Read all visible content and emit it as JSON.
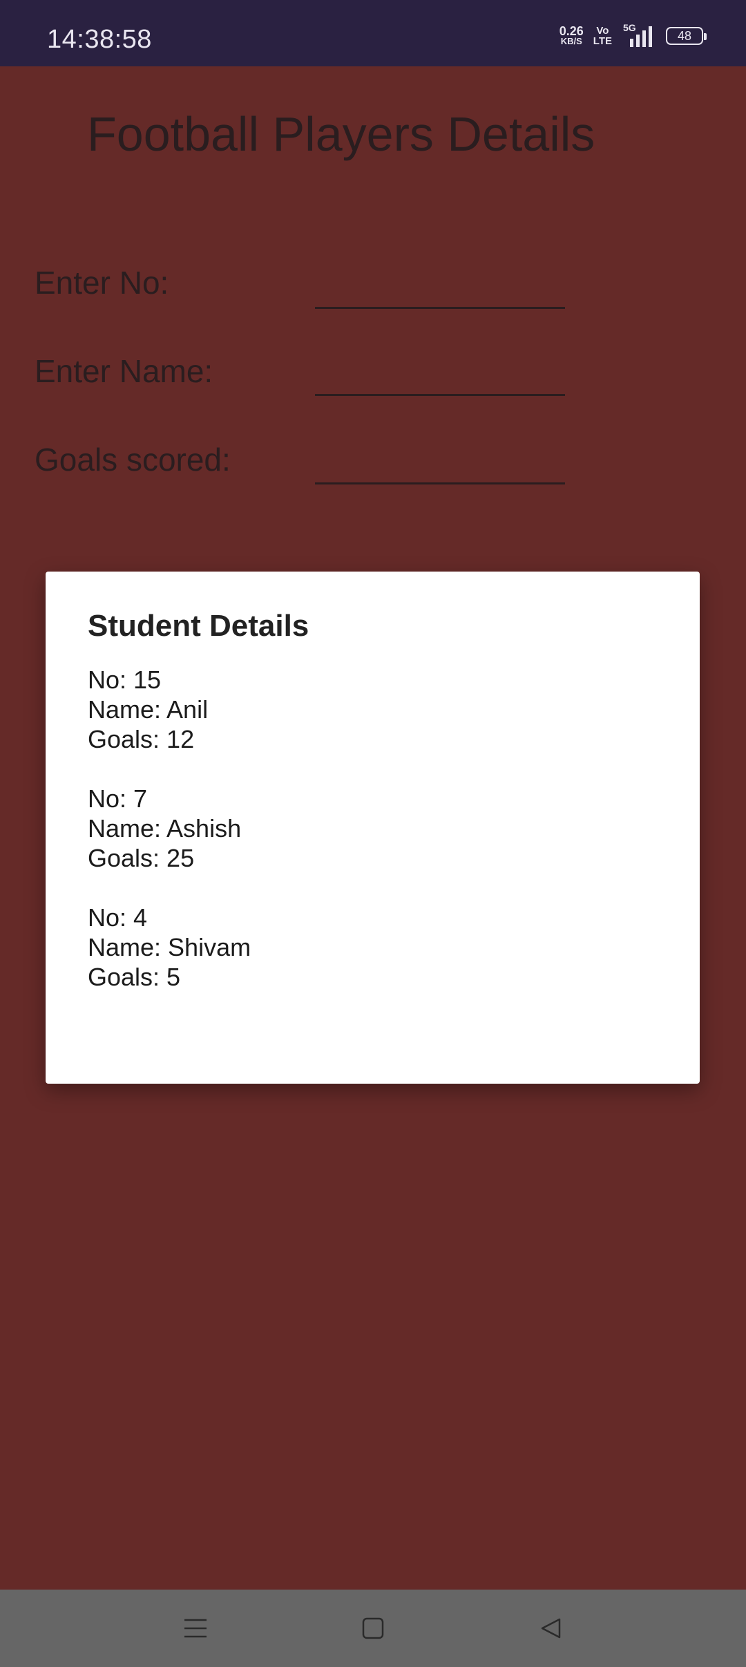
{
  "status_bar": {
    "time": "14:38:58",
    "net_speed_value": "0.26",
    "net_speed_unit": "KB/S",
    "volte_top": "Vo",
    "volte_bottom": "LTE",
    "signal_label": "5G",
    "battery_level": "48"
  },
  "app": {
    "title": "Football Players Details",
    "form": {
      "no_label": "Enter No:",
      "no_value": "",
      "name_label": "Enter Name:",
      "name_value": "",
      "goals_label": "Goals scored:",
      "goals_value": ""
    }
  },
  "dialog": {
    "title": "Student Details",
    "records": [
      {
        "no": "No: 15",
        "name": "Name: Anil",
        "goals": "Goals: 12"
      },
      {
        "no": "No: 7",
        "name": "Name: Ashish",
        "goals": "Goals: 25"
      },
      {
        "no": "No: 4",
        "name": "Name: Shivam",
        "goals": "Goals: 5"
      }
    ]
  },
  "nav_bar": {
    "icons": [
      "menu-icon",
      "home-icon",
      "back-icon"
    ]
  },
  "colors": {
    "status_bar": "#2a2141",
    "background": "#652a28",
    "dialog": "#ffffff",
    "nav_bar": "#666666"
  }
}
